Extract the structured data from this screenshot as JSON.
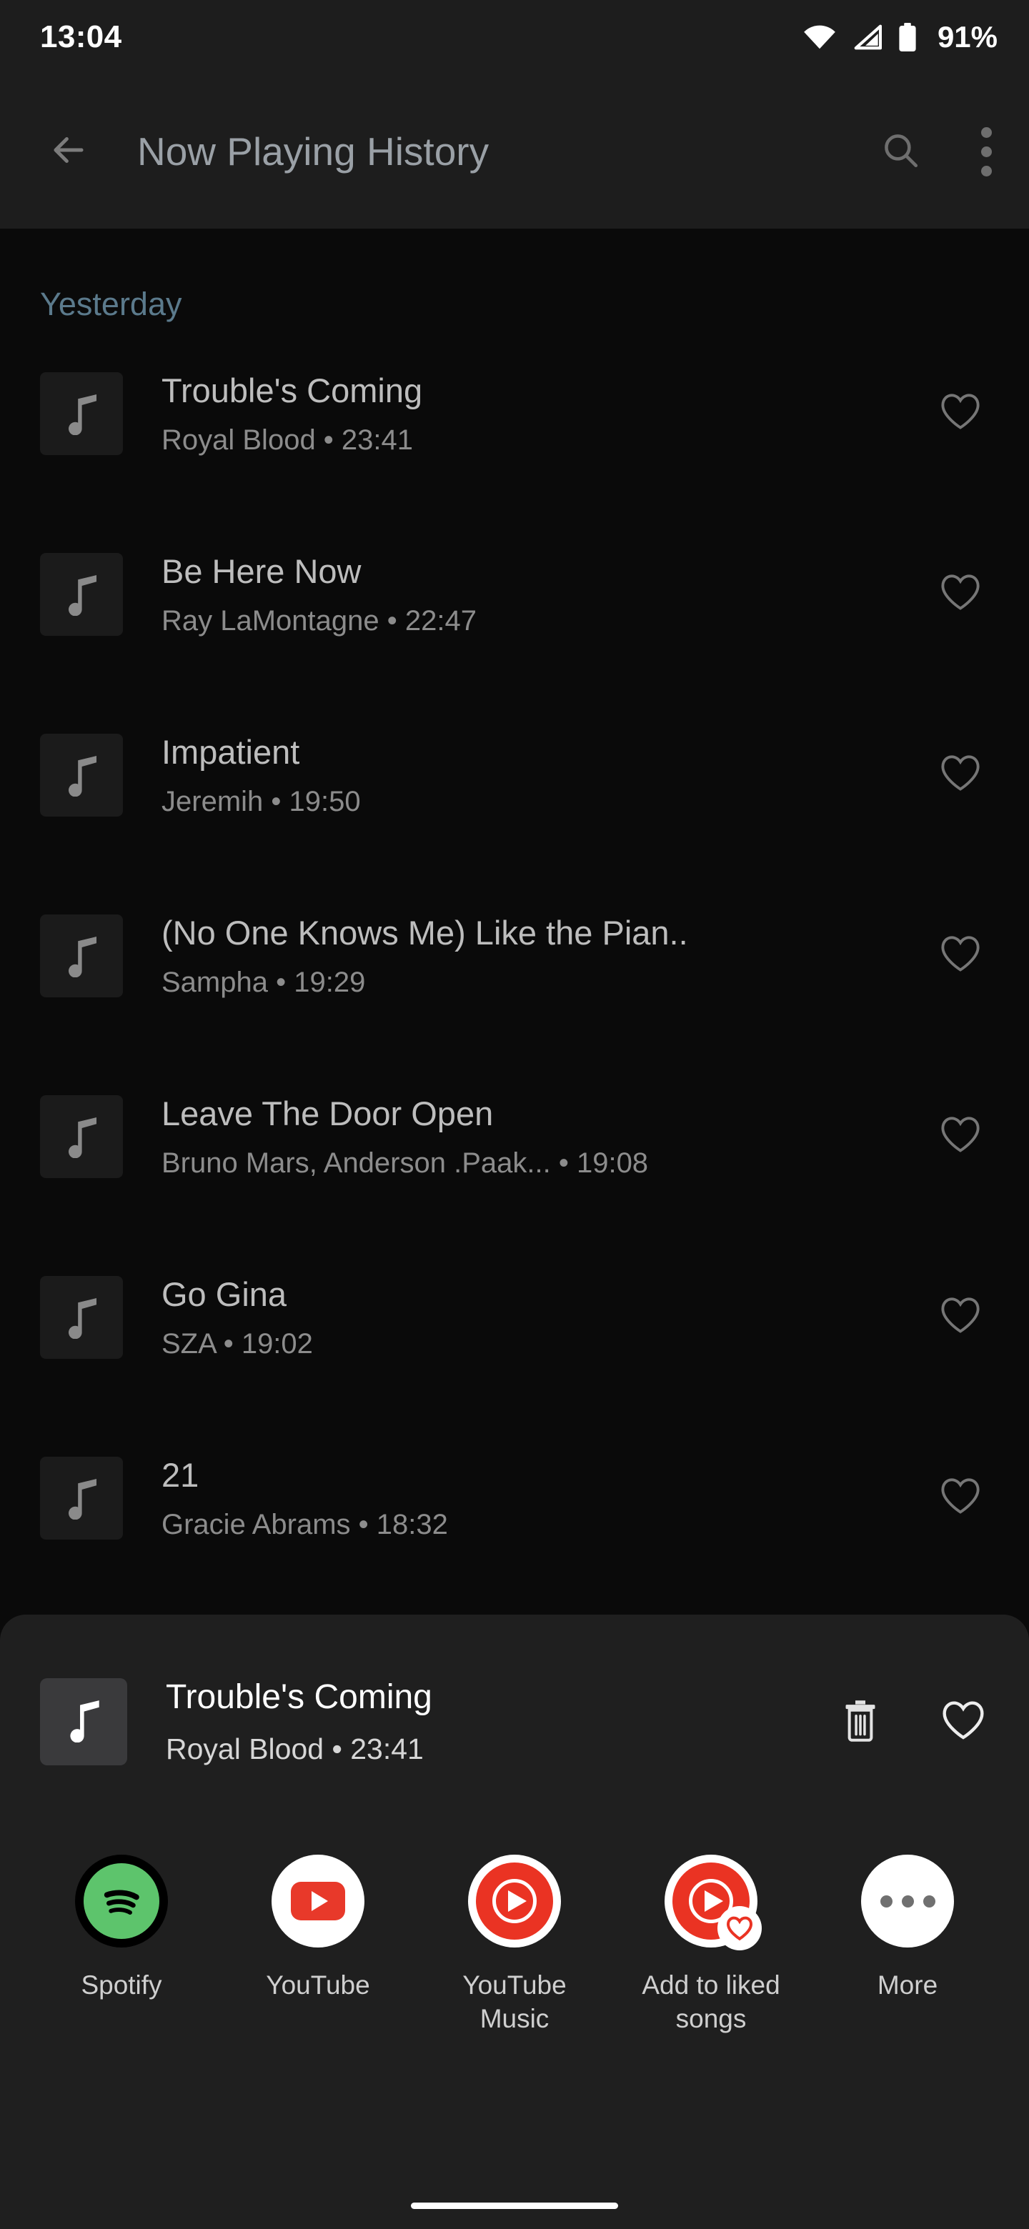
{
  "status_bar": {
    "time": "13:04",
    "battery_percent": "91%",
    "icons": [
      "wifi-icon",
      "cellular-signal-icon",
      "battery-icon"
    ]
  },
  "app_bar": {
    "back_icon": "back-arrow-icon",
    "title": "Now Playing History",
    "search_icon": "search-icon",
    "overflow_icon": "overflow-menu-icon"
  },
  "list": {
    "section_header": "Yesterday",
    "songs": [
      {
        "title": "Trouble's Coming",
        "subtitle": "Royal Blood • 23:41",
        "thumb_icon": "music-note-icon",
        "like_icon": "heart-outline-icon"
      },
      {
        "title": "Be Here Now",
        "subtitle": "Ray LaMontagne • 22:47",
        "thumb_icon": "music-note-icon",
        "like_icon": "heart-outline-icon"
      },
      {
        "title": "Impatient",
        "subtitle": "Jeremih • 19:50",
        "thumb_icon": "music-note-icon",
        "like_icon": "heart-outline-icon"
      },
      {
        "title": "(No One Knows Me) Like the Pian..",
        "subtitle": "Sampha • 19:29",
        "thumb_icon": "music-note-icon",
        "like_icon": "heart-outline-icon"
      },
      {
        "title": "Leave The Door Open",
        "subtitle": "Bruno Mars, Anderson .Paak... • 19:08",
        "thumb_icon": "music-note-icon",
        "like_icon": "heart-outline-icon"
      },
      {
        "title": "Go Gina",
        "subtitle": "SZA • 19:02",
        "thumb_icon": "music-note-icon",
        "like_icon": "heart-outline-icon"
      },
      {
        "title": "21",
        "subtitle": "Gracie Abrams • 18:32",
        "thumb_icon": "music-note-icon",
        "like_icon": "heart-outline-icon"
      }
    ]
  },
  "sheet": {
    "track": {
      "title": "Trouble's Coming",
      "subtitle": "Royal Blood • 23:41",
      "thumb_icon": "music-note-icon"
    },
    "delete_icon": "trash-icon",
    "like_icon": "heart-outline-icon",
    "share_targets": [
      {
        "label": "Spotify",
        "icon": "spotify-icon"
      },
      {
        "label": "YouTube",
        "icon": "youtube-icon"
      },
      {
        "label": "YouTube Music",
        "icon": "youtube-music-icon"
      },
      {
        "label": "Add to liked songs",
        "icon": "youtube-music-liked-icon"
      },
      {
        "label": "More",
        "icon": "more-dots-icon"
      }
    ]
  },
  "colors": {
    "background": "#0a0a0a",
    "bar": "#1d1d1d",
    "sheet": "#1f1f1f",
    "section_header": "#5b7a8c",
    "title_text": "#bdbdbd",
    "subtitle_text": "#8c8c8c",
    "spotify_green": "#5dc46c",
    "youtube_red": "#e8392a"
  }
}
